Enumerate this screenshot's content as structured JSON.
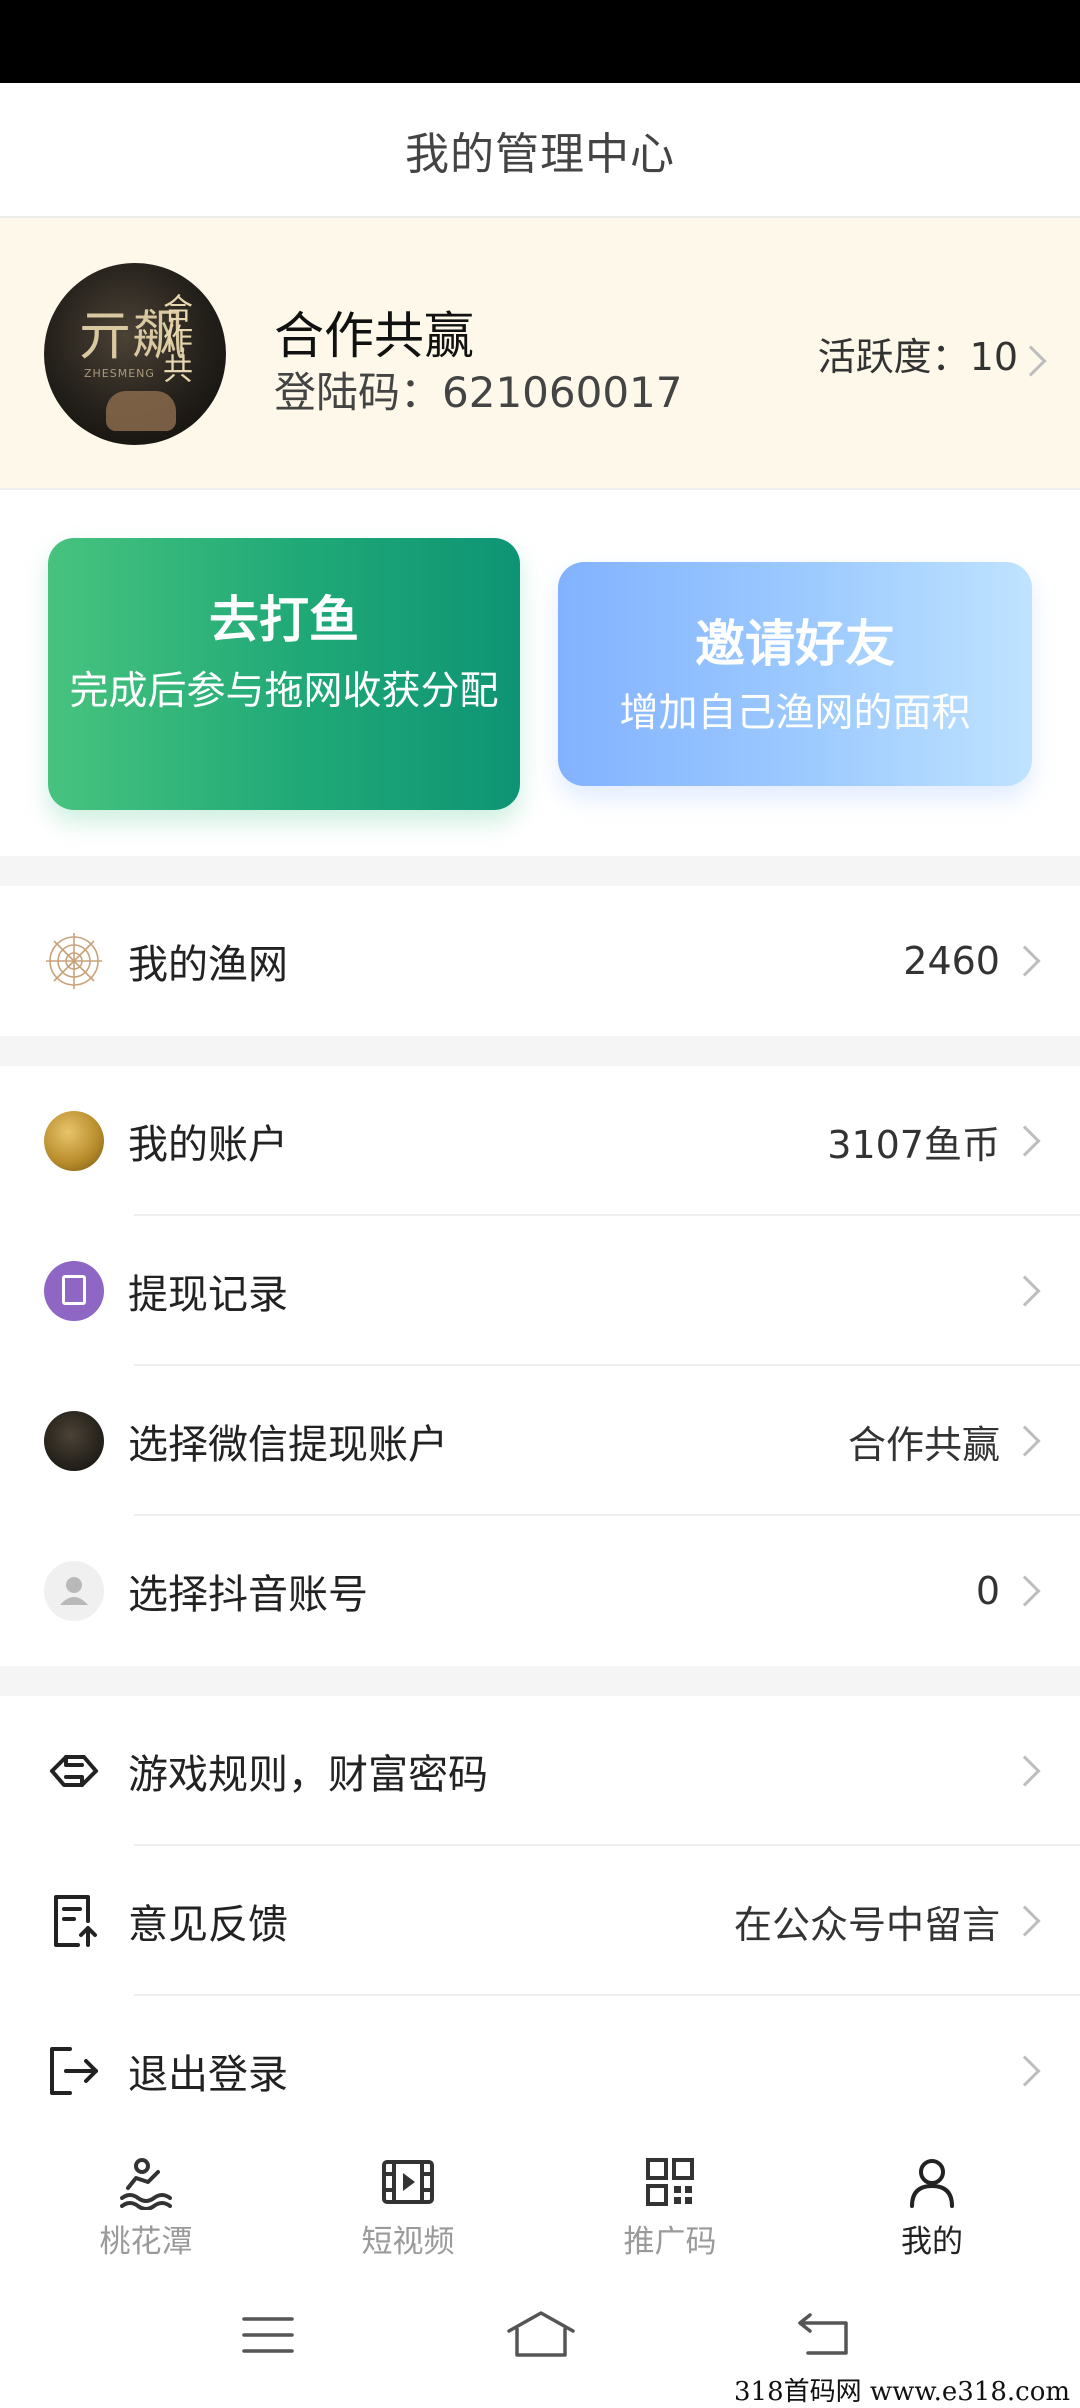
{
  "header": {
    "title": "我的管理中心"
  },
  "profile": {
    "name": "合作共赢",
    "login_code": "登陆码：621060017",
    "activity": "活跃度：10",
    "avatar_text": {
      "big": "亓飙",
      "side": "合作共",
      "small": "ZHESMENG"
    }
  },
  "cards": {
    "fishing": {
      "title": "去打鱼",
      "subtitle": "完成后参与拖网收获分配"
    },
    "invite": {
      "title": "邀请好友",
      "subtitle": "增加自己渔网的面积"
    }
  },
  "menu": {
    "net": {
      "label": "我的渔网",
      "value": "2460"
    },
    "account": {
      "label": "我的账户",
      "value": "3107鱼币"
    },
    "withdraw_records": {
      "label": "提现记录",
      "value": ""
    },
    "wechat_account": {
      "label": "选择微信提现账户",
      "value": "合作共赢"
    },
    "douyin_account": {
      "label": "选择抖音账号",
      "value": "0"
    },
    "rules": {
      "label": "游戏规则，财富密码",
      "value": ""
    },
    "feedback": {
      "label": "意见反馈",
      "value": "在公众号中留言"
    },
    "logout": {
      "label": "退出登录",
      "value": ""
    }
  },
  "tabbar": {
    "items": [
      {
        "label": "桃花潭",
        "icon": "fishing-icon",
        "active": false
      },
      {
        "label": "短视频",
        "icon": "video-icon",
        "active": false
      },
      {
        "label": "推广码",
        "icon": "qrcode-icon",
        "active": false
      },
      {
        "label": "我的",
        "icon": "person-icon",
        "active": true
      }
    ]
  },
  "watermark": "318首码网 www.e318.com",
  "colors": {
    "profile_bg": "#fdf8e9",
    "fish_card": "#1fa877",
    "invite_card": "#9ecbff",
    "withdraw_icon": "#8e67c4"
  }
}
